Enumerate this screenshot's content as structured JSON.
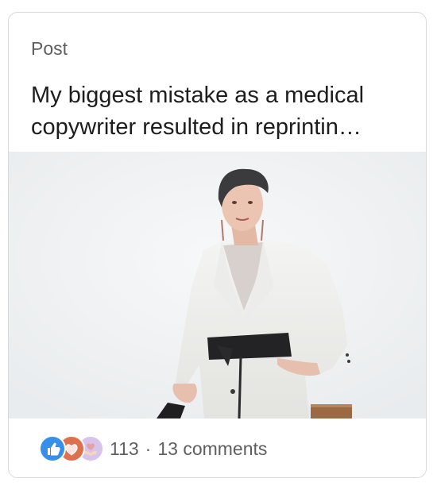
{
  "card": {
    "kind_label": "Post",
    "title": "My biggest mistake as a medical\ncopywriter resulted in reprintin…"
  },
  "footer": {
    "reaction_icons": [
      "like-icon",
      "love-icon",
      "support-icon"
    ],
    "reaction_count": "113",
    "separator": "·",
    "comments_label": "13 comments"
  },
  "colors": {
    "like": "#378fe9",
    "love": "#df704d",
    "support": "#d8c3ea",
    "text_secondary": "#5f5f5f",
    "text_primary": "#1d1d1d"
  }
}
